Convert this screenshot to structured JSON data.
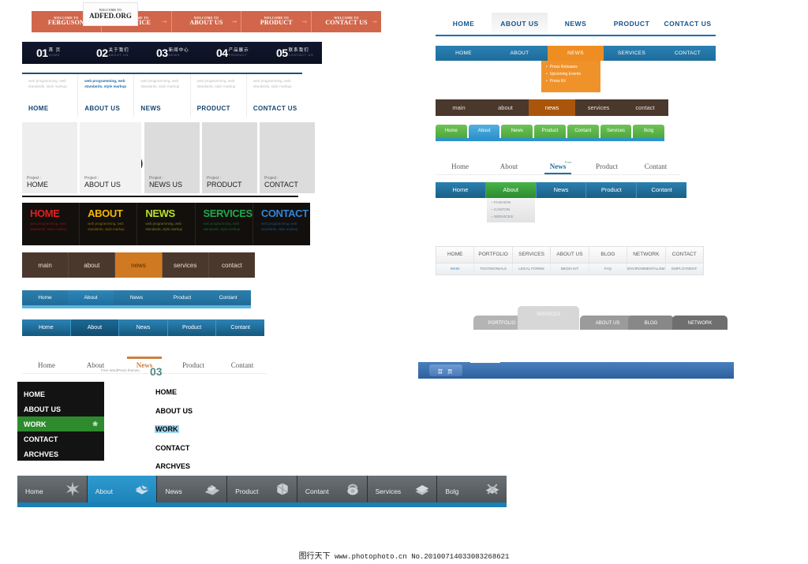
{
  "welcome_bar": {
    "logo": {
      "small": "WELCOME TO",
      "big": "ADFED.ORG",
      "icon": "star-icon"
    },
    "items": [
      {
        "small": "WELCOME TO",
        "big": "FERGUSON",
        "arrow": "arrow-right-icon"
      },
      {
        "small": "WELCOME TO",
        "big": "SERVICE",
        "arrow": "arrow-right-icon"
      },
      {
        "small": "WELCOME TO",
        "big": "ABOUT US",
        "arrow": "arrow-right-icon"
      },
      {
        "small": "WELCOME TO",
        "big": "PRODUCT",
        "arrow": "arrow-right-icon"
      },
      {
        "small": "WELCOME TO",
        "big": "CONTACT US",
        "arrow": "arrow-right-icon"
      }
    ],
    "bg_color": "#d2664a"
  },
  "numbered_nav": {
    "bg_color": "#0b1020",
    "items": [
      {
        "num": "01",
        "cn": "首 页",
        "en": "HOME"
      },
      {
        "num": "02",
        "cn": "关于我们",
        "en": "ABOUT US"
      },
      {
        "num": "03",
        "cn": "新闻中心",
        "en": "NEWS"
      },
      {
        "num": "04",
        "cn": "产品展示",
        "en": "PRODUCT"
      },
      {
        "num": "05",
        "cn": "联系我们",
        "en": "CONTACT US"
      }
    ]
  },
  "card_nav": {
    "accent": "#1c4f7c",
    "items": [
      {
        "desc": "web programming, web standards, style markup",
        "label": "HOME",
        "active": false
      },
      {
        "desc": "web programming, web standards, style markup",
        "label": "ABOUT US",
        "active": true
      },
      {
        "desc": "web programming, web standards, style markup",
        "label": "NEWS",
        "active": false
      },
      {
        "desc": "web programming, web standards, style markup",
        "label": "PRODUCT",
        "active": false
      },
      {
        "desc": "web programming, web standards, style markup",
        "label": "CONTACT US",
        "active": false
      }
    ]
  },
  "thumbs": {
    "prefix": "Project :",
    "items": [
      {
        "name": "HOME"
      },
      {
        "name": "ABOUT US"
      },
      {
        "name": "NEWS US"
      },
      {
        "name": "PRODUCT"
      },
      {
        "name": "CONTACT"
      }
    ]
  },
  "dark_nav": {
    "bg_color": "#120f0d",
    "items": [
      {
        "label": "HOME",
        "color": "#e02020",
        "desc": "web programming, web standards, style.markup"
      },
      {
        "label": "ABOUT",
        "color": "#f2b705",
        "desc": "web programming, web standards, style.markup"
      },
      {
        "label": "NEWS",
        "color": "#b9e22a",
        "desc": "web programming, web standards, style.markup"
      },
      {
        "label": "SERVICES",
        "color": "#1fa84a",
        "desc": "web programming, web standards, style.markup"
      },
      {
        "label": "CONTACT",
        "color": "#2f86d6",
        "desc": "web programming, web standards, style.markup"
      }
    ]
  },
  "brown_nav": {
    "bg_color": "#4a382c",
    "active_color": "#cf7a22",
    "items": [
      {
        "label": "main",
        "active": false
      },
      {
        "label": "about",
        "active": false
      },
      {
        "label": "news",
        "active": true
      },
      {
        "label": "services",
        "active": false
      },
      {
        "label": "contact",
        "active": false
      }
    ]
  },
  "blue_pipe_nav": {
    "items": [
      {
        "label": "Home",
        "active": false
      },
      {
        "label": "About",
        "active": true
      },
      {
        "label": "News",
        "active": false
      },
      {
        "label": "Product",
        "active": false
      },
      {
        "label": "Contant",
        "active": false
      }
    ]
  },
  "blue_block_nav": {
    "items": [
      {
        "label": "Home",
        "active": false
      },
      {
        "label": "About",
        "active": true
      },
      {
        "label": "News",
        "active": false
      },
      {
        "label": "Product",
        "active": false
      },
      {
        "label": "Contant",
        "active": false
      }
    ]
  },
  "serif_nav": {
    "accent": "#cd7f3e",
    "note": "Free WordPress themes.",
    "badge": "03",
    "items": [
      {
        "label": "Home",
        "active": false
      },
      {
        "label": "About",
        "active": false
      },
      {
        "label": "News",
        "active": true
      },
      {
        "label": "Product",
        "active": false
      },
      {
        "label": "Contant",
        "active": false
      }
    ]
  },
  "vertical_menu": {
    "bg_color": "#131313",
    "active_color": "#2d8b2d",
    "items": [
      {
        "label": "HOME",
        "active": false,
        "icon": ""
      },
      {
        "label": "ABOUT US",
        "active": false,
        "icon": ""
      },
      {
        "label": "WORK",
        "active": true,
        "icon": "flower-icon"
      },
      {
        "label": "CONTACT",
        "active": false,
        "icon": ""
      },
      {
        "label": "ARCHVES",
        "active": false,
        "icon": ""
      }
    ]
  },
  "vertical_list": {
    "active_color": "#9fd6ef",
    "items": [
      {
        "label": "HOME",
        "active": false
      },
      {
        "label": "ABOUT US",
        "active": false
      },
      {
        "label": "WORK",
        "active": true
      },
      {
        "label": "CONTACT",
        "active": false
      },
      {
        "label": "ARCHVES",
        "active": false
      }
    ]
  },
  "gray_tabs": {
    "active_color": "#1a7fb4",
    "items": [
      {
        "label": "Home",
        "active": false,
        "icon": "star-burst-icon"
      },
      {
        "label": "About",
        "active": true,
        "icon": "magnifier-book-icon"
      },
      {
        "label": "News",
        "active": false,
        "icon": "newspaper-icon"
      },
      {
        "label": "Product",
        "active": false,
        "icon": "box-icon"
      },
      {
        "label": "Contant",
        "active": false,
        "icon": "phone-icon"
      },
      {
        "label": "Services",
        "active": false,
        "icon": "layers-icon"
      },
      {
        "label": "Bolg",
        "active": false,
        "icon": "pen-icon"
      }
    ]
  },
  "right": {
    "top_nav": {
      "accent": "#1b6fa8",
      "items": [
        {
          "label": "HOME",
          "active": false
        },
        {
          "label": "ABOUT US",
          "active": true
        },
        {
          "label": "NEWS",
          "active": false
        },
        {
          "label": "PRODUCT",
          "active": false
        },
        {
          "label": "CONTACT US",
          "active": false
        }
      ]
    },
    "blue_nav": {
      "active_color": "#ee8d22",
      "items": [
        {
          "label": "HOME",
          "active": false
        },
        {
          "label": "ABOUT",
          "active": false
        },
        {
          "label": "NEWS",
          "active": true
        },
        {
          "label": "SERVICES",
          "active": false
        },
        {
          "label": "CONTACT",
          "active": false
        }
      ],
      "dropdown": [
        {
          "label": "Press  Releases"
        },
        {
          "label": "Upcoming  Events"
        },
        {
          "label": "Press  Kit"
        }
      ]
    },
    "brown_nav": {
      "items": [
        {
          "label": "main",
          "active": false
        },
        {
          "label": "about",
          "active": false
        },
        {
          "label": "news",
          "active": true
        },
        {
          "label": "services",
          "active": false
        },
        {
          "label": "contact",
          "active": false
        }
      ]
    },
    "green_tabs": {
      "items": [
        {
          "label": "Home",
          "active": false
        },
        {
          "label": "About",
          "active": true
        },
        {
          "label": "News",
          "active": false
        },
        {
          "label": "Product",
          "active": false
        },
        {
          "label": "Contant",
          "active": false
        },
        {
          "label": "Services",
          "active": false
        },
        {
          "label": "Bolg",
          "active": false
        }
      ]
    },
    "serif_nav": {
      "sup": "Free",
      "items": [
        {
          "label": "Home",
          "active": false
        },
        {
          "label": "About",
          "active": false
        },
        {
          "label": "News",
          "active": true
        },
        {
          "label": "Product",
          "active": false
        },
        {
          "label": "Contant",
          "active": false
        }
      ]
    },
    "bluegreen_nav": {
      "items": [
        {
          "label": "Home",
          "active": false
        },
        {
          "label": "About",
          "active": true
        },
        {
          "label": "News",
          "active": false
        },
        {
          "label": "Product",
          "active": false
        },
        {
          "label": "Contant",
          "active": false
        }
      ],
      "dropdown": [
        {
          "label": "– FASHION"
        },
        {
          "label": "– CANTON"
        },
        {
          "label": "– SERVICES"
        }
      ]
    },
    "gray_two_row": {
      "row1": [
        {
          "label": "HOME"
        },
        {
          "label": "PORTFOLIO"
        },
        {
          "label": "SERVICES"
        },
        {
          "label": "ABOUT US"
        },
        {
          "label": "BLOG"
        },
        {
          "label": "NETWORK"
        },
        {
          "label": "CONTACT"
        }
      ],
      "row2": [
        {
          "label": "MAIN",
          "active": true
        },
        {
          "label": "TESTIMONIALS",
          "active": false
        },
        {
          "label": "LEGAL FORMS",
          "active": false
        },
        {
          "label": "MEDIA KIT",
          "active": false
        },
        {
          "label": "FAQ",
          "active": false
        },
        {
          "label": "ENVIRONMENTALISM",
          "active": false
        },
        {
          "label": "EMPLOYMENT",
          "active": false
        }
      ]
    },
    "round_tabs": {
      "items": [
        {
          "label": "PORTFOLIO",
          "active": false,
          "color": "#b4b4b4"
        },
        {
          "label": "SERVICES",
          "active": true,
          "color": "#d7d7d7"
        },
        {
          "label": "ABOUT US",
          "active": false,
          "color": "#9b9b9b"
        },
        {
          "label": "BLOG",
          "active": false,
          "color": "#888888"
        },
        {
          "label": "NETWORK",
          "active": false,
          "color": "#6f6f6f"
        }
      ]
    },
    "blue_bar": {
      "tab_label": "首 页",
      "bg_color": "#2e5f9e"
    }
  },
  "footer": {
    "brand": "图行天下",
    "url": "www.photophoto.cn",
    "code": "No.20100714033083268621"
  }
}
